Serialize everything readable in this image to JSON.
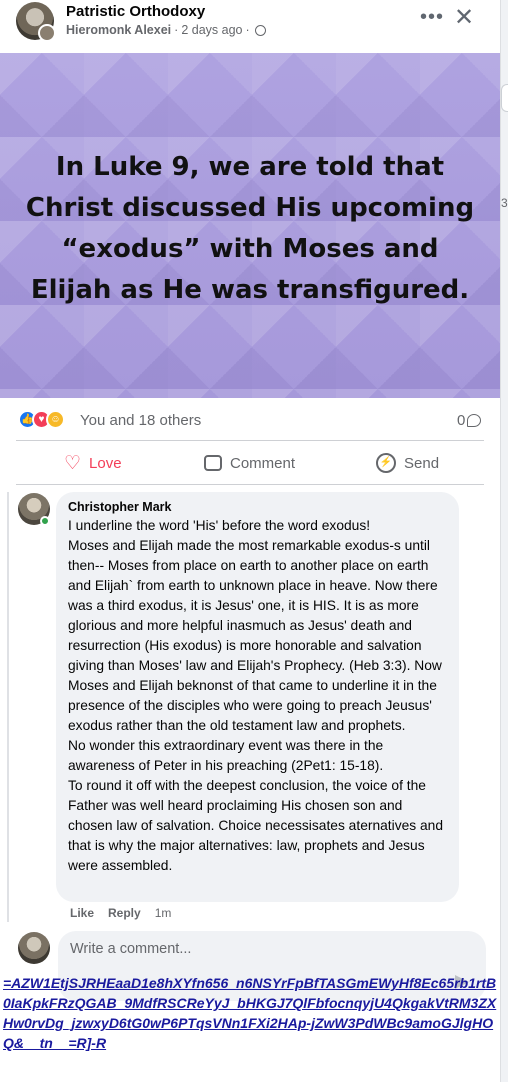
{
  "header": {
    "page_name": "Patristic Orthodoxy",
    "author": "Hieromonk Alexei",
    "time": "2 days ago",
    "separator": "·",
    "more_glyph": "•••",
    "close_glyph": "✕"
  },
  "post_image": {
    "quote": "In Luke 9, we are told that Christ discussed His upcoming “exodus” with Moses and Elijah as He was transfigured."
  },
  "reactions": {
    "summary": "You and 18 others",
    "comment_count": "0"
  },
  "actions": {
    "love_label": "Love",
    "comment_label": "Comment",
    "send_label": "Send"
  },
  "comment": {
    "author": "Christopher Mark",
    "text": "I underline the word 'His' before the word exodus!\nMoses and Elijah made the most remarkable exodus-s until then-- Moses from place on earth to another place on earth and Elijah` from earth to unknown place in heave. Now there was a third exodus, it is Jesus' one, it is HIS. It is as more glorious and more helpful inasmuch as Jesus' death and resurrection (His exodus) is more honorable and salvation giving than Moses' law and Elijah's Prophecy. (Heb 3:3). Now Moses and Elijah beknonst of that came to underline it in the presence of the disciples who were going to preach Jeusus' exodus rather than the old testament law and prophets.\nNo wonder this extraordinary event was there in the awareness of Peter in his preaching (2Pet1: 15-18).\nTo round it off with the deepest conclusion, the voice of the Father was well heard proclaiming His chosen son and chosen law of salvation. Choice necessisates aternatives and that is why the major alternatives: law, prophets and Jesus were assembled.",
    "like_label": "Like",
    "reply_label": "Reply",
    "time": "1m"
  },
  "write_comment": {
    "placeholder": "Write a comment..."
  },
  "edge": {
    "char": "3"
  },
  "url_overlay": "=AZW1EtjSJRHEaaD1e8hXYfn656_n6NSYrFpBfTASGmEWyHf8Ec65rb1rtB0IaKpkFRzQGAB_9MdfRSCReYyJ_bHKGJ7QlFbfocnqyjU4QkgakVtRM3ZXHw0rvDg_jzwxyD6tG0wP6PTqsVNn1FXi2HAp-jZwW3PdWBc9amoGJlgHOQ&__tn__=R]-R",
  "colors": {
    "love": "#f33e58",
    "like": "#1877f2",
    "image_bg": "#a99cdb",
    "online": "#31a24c"
  }
}
